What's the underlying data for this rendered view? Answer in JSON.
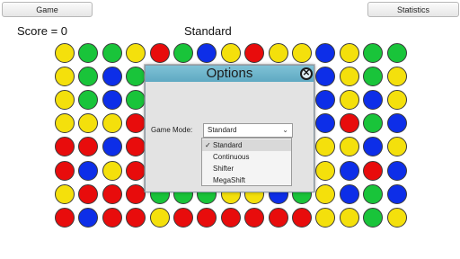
{
  "top_bar": {
    "game_label": "Game",
    "statistics_label": "Statistics"
  },
  "status": {
    "score_text": "Score = 0",
    "mode_text": "Standard"
  },
  "colors": {
    "y": "#f4e00c",
    "g": "#19c43a",
    "b": "#0d2ee8",
    "r": "#e80c0c"
  },
  "board": {
    "rows": [
      "yggyrgbyryybygg",
      "ygbgrrgybgybygy",
      "ygbgyyyybbbbyby",
      "yyyrrrbbyrrbrgb",
      "rrbrrrryyybyyby",
      "rbyrrrrbyrbybrb",
      "yrrrgggyybgybgb",
      "rbrryrrrrrryygy"
    ]
  },
  "dialog": {
    "title": "Options",
    "game_mode_label": "Game Mode:",
    "selected_mode": "Standard",
    "chevron": "⌄",
    "close_symbol": "✕",
    "check_symbol": "✓",
    "options": [
      "Standard",
      "Continuous",
      "Shifter",
      "MegaShift"
    ]
  }
}
